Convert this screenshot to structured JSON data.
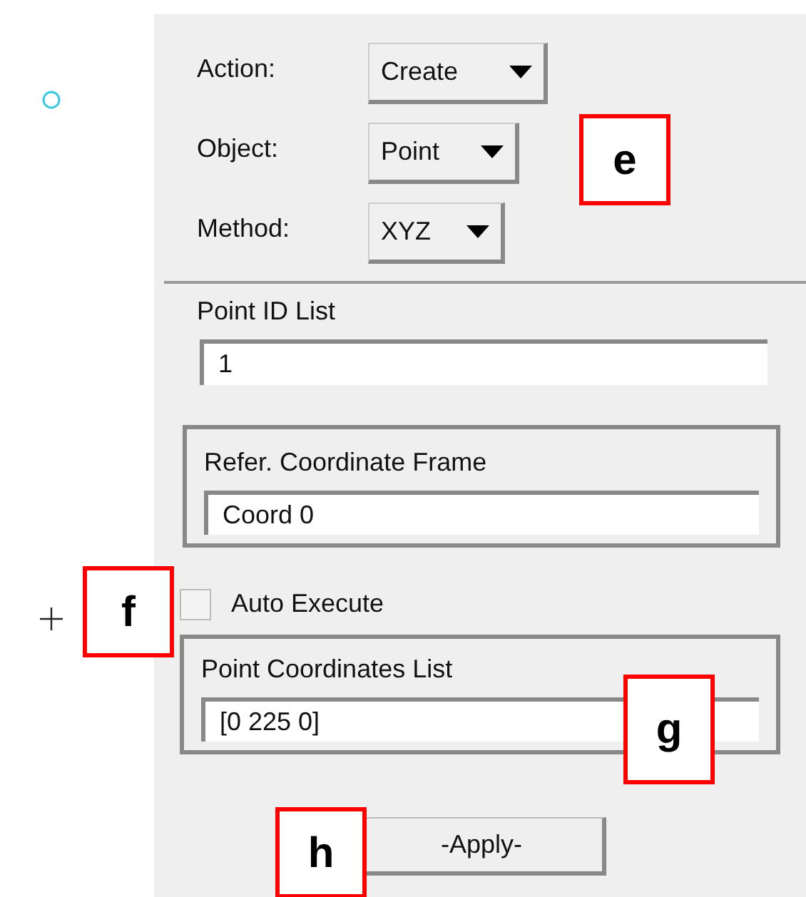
{
  "callouts": [
    "e",
    "f",
    "g",
    "h"
  ],
  "selectors": [
    {
      "label": "Action:",
      "value": "Create"
    },
    {
      "label": "Object:",
      "value": "Point"
    },
    {
      "label": "Method:",
      "value": "XYZ"
    }
  ],
  "point_id_list": {
    "label": "Point ID List",
    "value": "1"
  },
  "reference_frame": {
    "label": "Refer. Coordinate Frame",
    "value": "Coord 0"
  },
  "auto_execute": {
    "label": "Auto Execute",
    "checked": false
  },
  "point_coordinates": {
    "label": "Point Coordinates List",
    "value": "[0 225 0]"
  },
  "apply_button": "-Apply-"
}
